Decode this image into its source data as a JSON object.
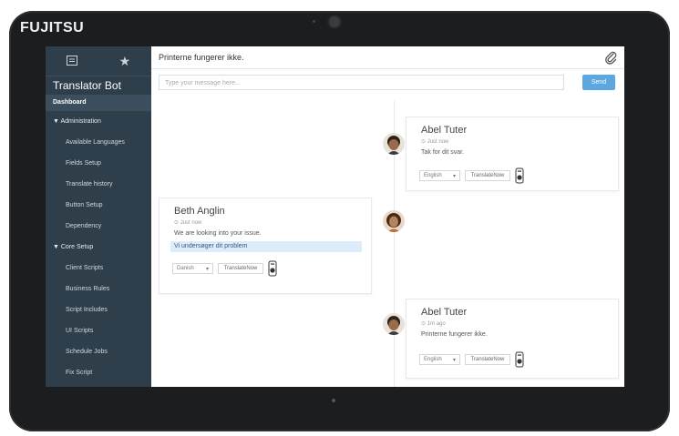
{
  "device": {
    "brand": "FUJITSU"
  },
  "sidebar": {
    "title": "Translator Bot",
    "dashboard": "Dashboard",
    "groups": [
      {
        "label": "▼ Administration",
        "items": [
          "Available Languages",
          "Fields Setup",
          "Translate history",
          "Button Setup",
          "Dependency"
        ]
      },
      {
        "label": "▼ Core Setup",
        "items": [
          "Client Scripts",
          "Business Rules",
          "Script Includes",
          "UI Scripts",
          "Schedule Jobs",
          "Fix Script"
        ]
      }
    ]
  },
  "header": {
    "title": "Printerne fungerer ikke."
  },
  "composer": {
    "placeholder": "Type your message here...",
    "send_label": "Send"
  },
  "messages": [
    {
      "name": "Abel Tuter",
      "time": "⊙ Just now",
      "text": "Tak for dit svar.",
      "lang": "English",
      "translate_label": "TranslateNow"
    },
    {
      "name": "Beth Anglin",
      "time": "⊙ Just now",
      "text": "We are looking into your issue.",
      "translation": "Vi undersøger dit problem",
      "lang": "Danish",
      "translate_label": "TranslateNow"
    },
    {
      "name": "Abel Tuter",
      "time": "⊙ 1m ago",
      "text": "Printerne fungerer ikke.",
      "lang": "English",
      "translate_label": "TranslateNow"
    }
  ],
  "colors": {
    "sidebar_bg": "#2f3e4b",
    "send_bg": "#5ba7e0",
    "highlight_bg": "#dcecfb"
  }
}
